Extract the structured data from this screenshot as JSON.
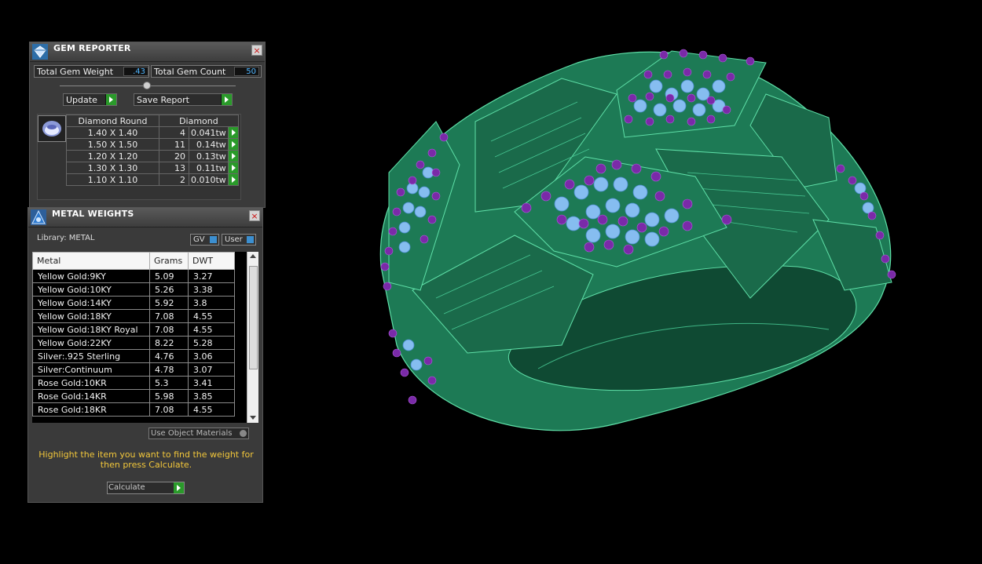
{
  "gem_reporter": {
    "title": "GEM REPORTER",
    "close": "×",
    "total_weight_label": "Total Gem Weight",
    "total_weight_value": ".43",
    "total_count_label": "Total Gem Count",
    "total_count_value": "50",
    "update_label": "Update",
    "save_report_label": "Save Report",
    "table_header": {
      "shape": "Diamond Round",
      "material": "Diamond"
    },
    "rows": [
      {
        "size": "1.40 X 1.40",
        "count": "4",
        "weight": "0.041tw"
      },
      {
        "size": "1.50 X 1.50",
        "count": "11",
        "weight": "0.14tw"
      },
      {
        "size": "1.20 X 1.20",
        "count": "20",
        "weight": "0.13tw"
      },
      {
        "size": "1.30 X 1.30",
        "count": "13",
        "weight": "0.11tw"
      },
      {
        "size": "1.10 X 1.10",
        "count": "2",
        "weight": "0.010tw"
      }
    ]
  },
  "metal_weights": {
    "title": "METAL WEIGHTS",
    "close": "×",
    "library_label": "Library: METAL",
    "gv_label": "GV",
    "user_label": "User",
    "columns": [
      "Metal",
      "Grams",
      "DWT"
    ],
    "rows": [
      {
        "metal": "Yellow Gold:9KY",
        "grams": "5.09",
        "dwt": "3.27"
      },
      {
        "metal": "Yellow Gold:10KY",
        "grams": "5.26",
        "dwt": "3.38"
      },
      {
        "metal": "Yellow Gold:14KY",
        "grams": "5.92",
        "dwt": "3.8"
      },
      {
        "metal": "Yellow Gold:18KY",
        "grams": "7.08",
        "dwt": "4.55"
      },
      {
        "metal": "Yellow Gold:18KY Royal",
        "grams": "7.08",
        "dwt": "4.55"
      },
      {
        "metal": "Yellow Gold:22KY",
        "grams": "8.22",
        "dwt": "5.28"
      },
      {
        "metal": "Silver:.925 Sterling",
        "grams": "4.76",
        "dwt": "3.06"
      },
      {
        "metal": "Silver:Continuum",
        "grams": "4.78",
        "dwt": "3.07"
      },
      {
        "metal": "Rose Gold:10KR",
        "grams": "5.3",
        "dwt": "3.41"
      },
      {
        "metal": "Rose Gold:14KR",
        "grams": "5.98",
        "dwt": "3.85"
      },
      {
        "metal": "Rose Gold:18KR",
        "grams": "7.08",
        "dwt": "4.55"
      }
    ],
    "use_object_materials_label": "Use Object Materials",
    "hint": "Highlight the item you want to find the weight for then press Calculate.",
    "calculate_label": "Calculate"
  },
  "colors": {
    "ring_green": "#1f7a55",
    "gem_blue": "#7fb6ec",
    "prong_purple": "#7a2aa8",
    "value_blue": "#4fb5ff",
    "hint_yellow": "#f2c73a",
    "go_green": "#2a9a2a"
  }
}
